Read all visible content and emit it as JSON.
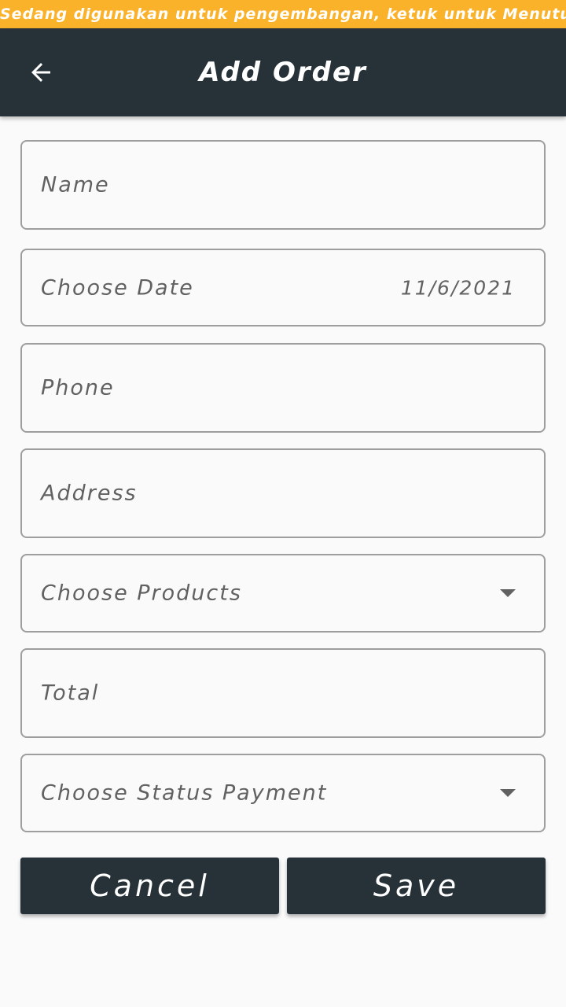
{
  "dev_banner": {
    "text": "Sedang digunakan untuk pengembangan, ketuk untuk Menutup"
  },
  "appbar": {
    "title": "Add Order",
    "back_icon": "arrow-back-icon",
    "background": "#263238"
  },
  "form": {
    "name_label": "Name",
    "date_label": "Choose Date",
    "date_value": "11/6/2021",
    "phone_label": "Phone",
    "address_label": "Address",
    "products_label": "Choose Products",
    "total_label": "Total",
    "status_payment_label": "Choose Status Payment",
    "dropdown_icon": "arrow-drop-down-icon"
  },
  "actions": {
    "cancel_label": "Cancel",
    "save_label": "Save"
  },
  "colors": {
    "banner": "#fbb22b",
    "appbar": "#263238",
    "button": "#263238",
    "field_border": "#9e9e9e",
    "label_text": "#616161",
    "background": "#fafafa"
  }
}
